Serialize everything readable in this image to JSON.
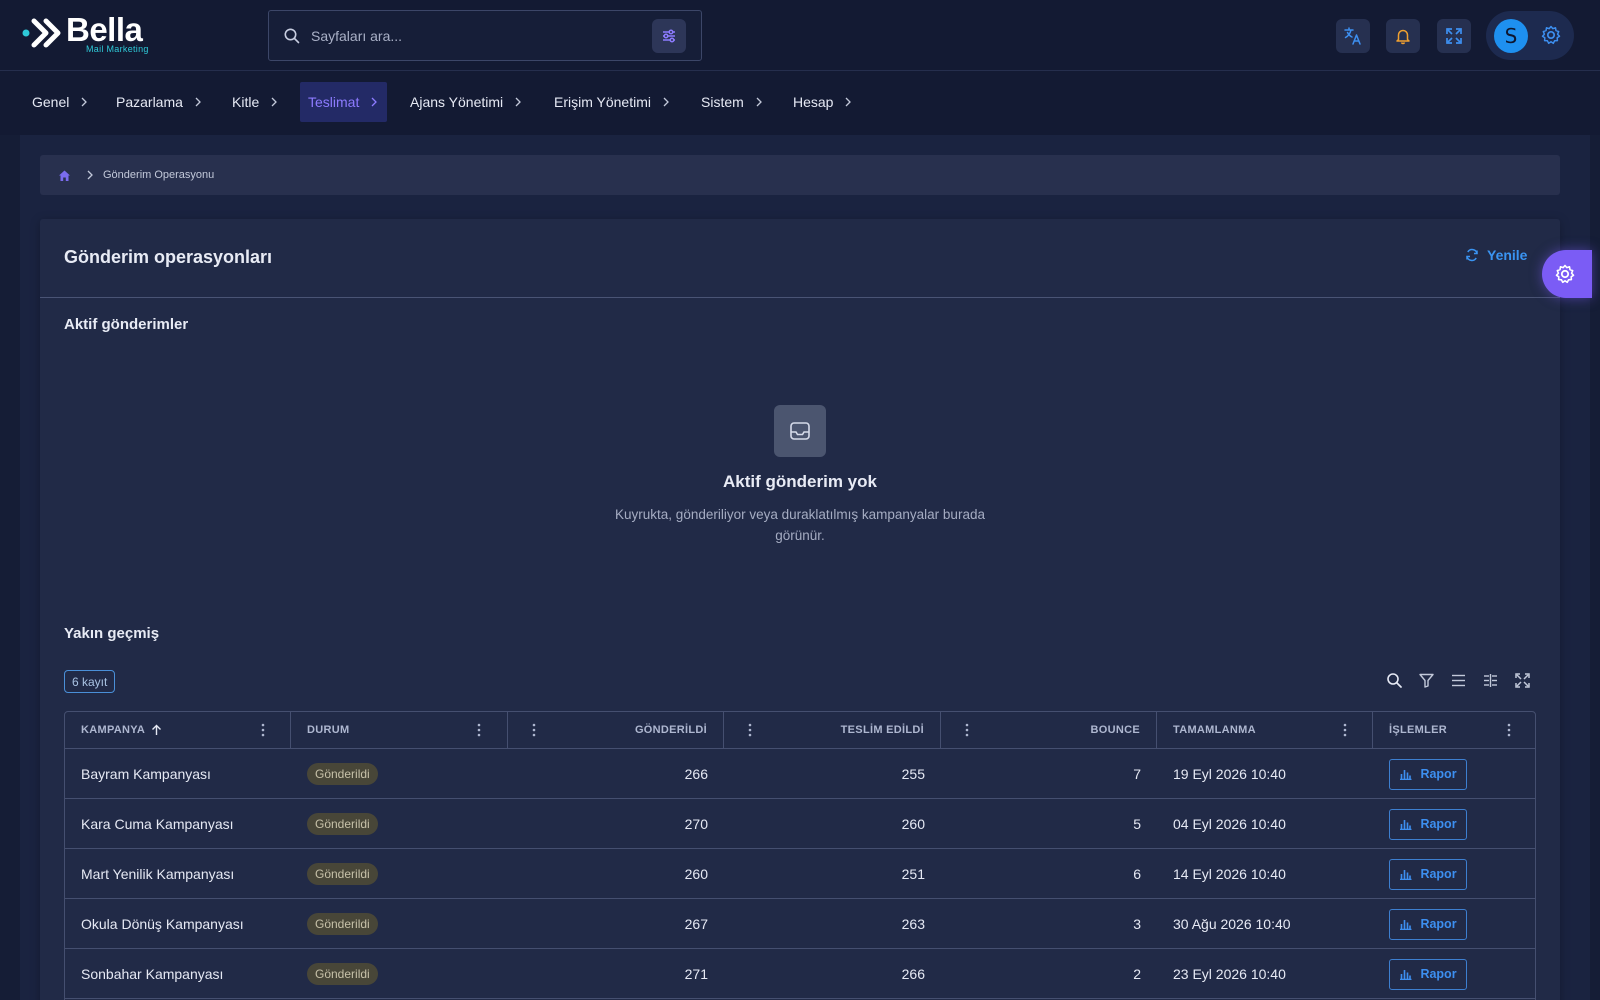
{
  "brand": {
    "name": "Bella",
    "tagline": "Mail Marketing"
  },
  "search": {
    "placeholder": "Sayfaları ara..."
  },
  "user": {
    "initial": "S"
  },
  "nav": {
    "items": [
      {
        "label": "Genel"
      },
      {
        "label": "Pazarlama"
      },
      {
        "label": "Kitle"
      },
      {
        "label": "Teslimat"
      },
      {
        "label": "Ajans Yönetimi"
      },
      {
        "label": "Erişim Yönetimi"
      },
      {
        "label": "Sistem"
      },
      {
        "label": "Hesap"
      }
    ],
    "active": "Teslimat"
  },
  "breadcrumb": {
    "current": "Gönderim Operasyonu"
  },
  "page": {
    "title": "Gönderim operasyonları",
    "refresh_label": "Yenile",
    "active_section": "Aktif gönderimler",
    "empty_title": "Aktif gönderim yok",
    "empty_desc": "Kuyrukta, gönderiliyor veya duraklatılmış kampanyalar burada görünür.",
    "history_section": "Yakın geçmiş",
    "record_count": "6 kayıt"
  },
  "table": {
    "headers": {
      "campaign": "KAMPANYA",
      "status": "DURUM",
      "sent": "GÖNDERİLDİ",
      "delivered": "TESLİM EDİLDİ",
      "bounce": "BOUNCE",
      "completed": "TAMAMLANMA",
      "actions": "İŞLEMLER"
    },
    "rows": [
      {
        "campaign": "Bayram Kampanyası",
        "status": "Gönderildi",
        "sent": "266",
        "delivered": "255",
        "bounce": "7",
        "completed": "19 Eyl 2026 10:40",
        "action": "Rapor"
      },
      {
        "campaign": "Kara Cuma Kampanyası",
        "status": "Gönderildi",
        "sent": "270",
        "delivered": "260",
        "bounce": "5",
        "completed": "04 Eyl 2026 10:40",
        "action": "Rapor"
      },
      {
        "campaign": "Mart Yenilik Kampanyası",
        "status": "Gönderildi",
        "sent": "260",
        "delivered": "251",
        "bounce": "6",
        "completed": "14 Eyl 2026 10:40",
        "action": "Rapor"
      },
      {
        "campaign": "Okula Dönüş Kampanyası",
        "status": "Gönderildi",
        "sent": "267",
        "delivered": "263",
        "bounce": "3",
        "completed": "30 Ağu 2026 10:40",
        "action": "Rapor"
      },
      {
        "campaign": "Sonbahar Kampanyası",
        "status": "Gönderildi",
        "sent": "271",
        "delivered": "266",
        "bounce": "2",
        "completed": "23 Eyl 2026 10:40",
        "action": "Rapor"
      }
    ]
  },
  "colors": {
    "accent": "#7b5cf5",
    "link": "#3a94f2",
    "background": "#151d36"
  }
}
